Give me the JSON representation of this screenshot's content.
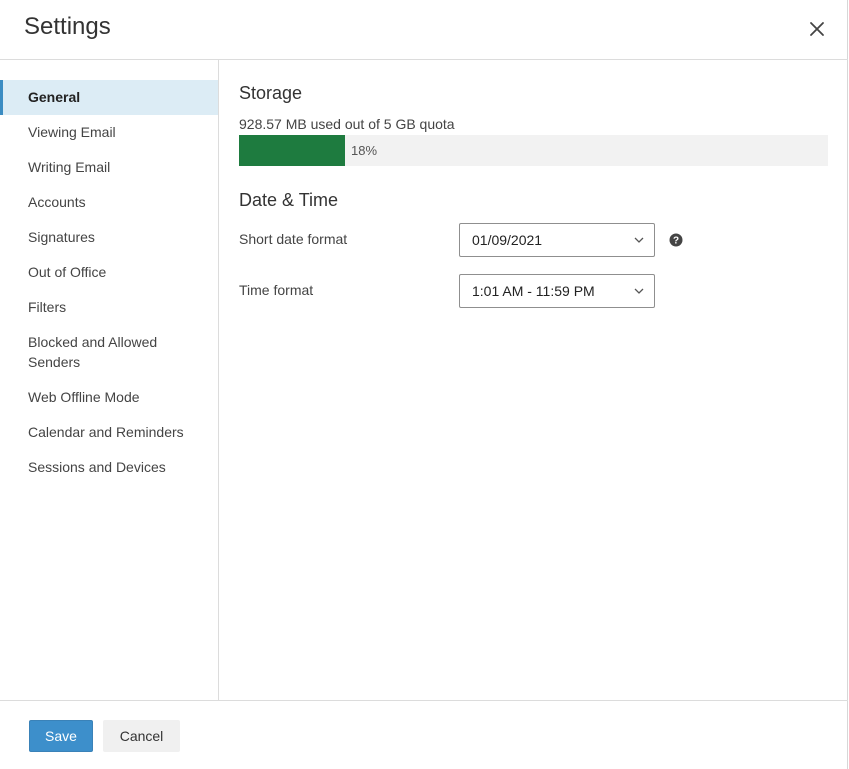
{
  "dialog": {
    "title": "Settings"
  },
  "sidebar": {
    "items": [
      {
        "label": "General",
        "active": true
      },
      {
        "label": "Viewing Email"
      },
      {
        "label": "Writing Email"
      },
      {
        "label": "Accounts"
      },
      {
        "label": "Signatures"
      },
      {
        "label": "Out of Office"
      },
      {
        "label": "Filters"
      },
      {
        "label": "Blocked and Allowed Senders"
      },
      {
        "label": "Web Offline Mode"
      },
      {
        "label": "Calendar and Reminders"
      },
      {
        "label": "Sessions and Devices"
      }
    ]
  },
  "storage": {
    "title": "Storage",
    "usage_text": "928.57 MB used out of 5 GB quota",
    "percent_label": "18%",
    "percent_value": 18,
    "fill_color": "#1e7b3f"
  },
  "datetime": {
    "title": "Date & Time",
    "short_date_label": "Short date format",
    "short_date_value": "01/09/2021",
    "time_format_label": "Time format",
    "time_format_value": "1:01 AM - 11:59 PM"
  },
  "footer": {
    "save_label": "Save",
    "cancel_label": "Cancel"
  },
  "colors": {
    "accent": "#3d8fcb",
    "active_bg": "#dcecf5"
  },
  "icons": {
    "close": "close-icon",
    "chevron": "chevron-down-icon",
    "help": "help-icon"
  }
}
